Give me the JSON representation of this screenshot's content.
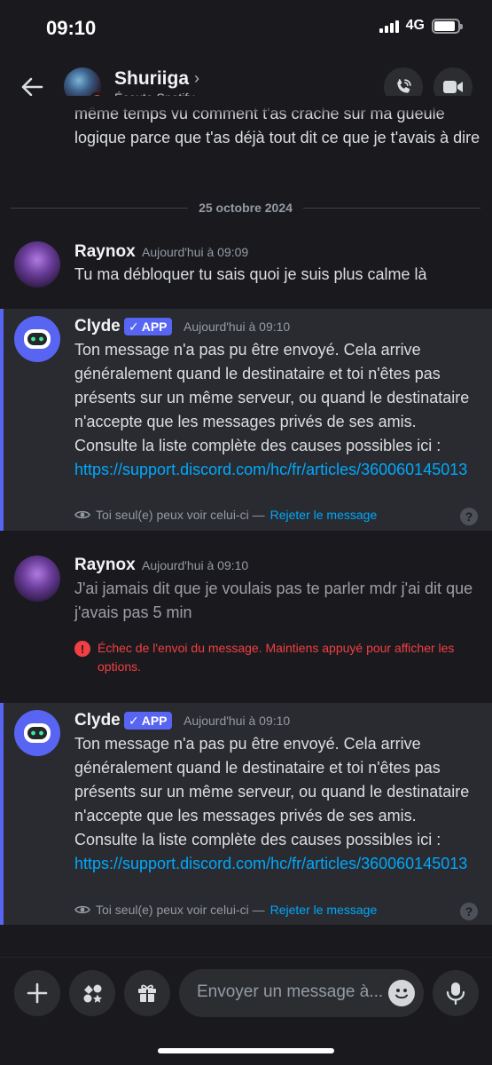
{
  "status_bar": {
    "time": "09:10",
    "network": "4G",
    "battery_fraction": 0.9
  },
  "header": {
    "user_name": "Shuriiga",
    "chevron": "›",
    "user_status": "Écoute Spotify",
    "icons": {
      "back": "arrow-left-icon",
      "call": "phone-call-icon",
      "video": "video-camera-icon"
    }
  },
  "chat": {
    "cut_off_text": "même temps vu comment t'as crache sur ma gueule logique parce que t'as déjà tout dit ce que je t'avais à dire",
    "date_divider": "25 octobre 2024",
    "messages": [
      {
        "author": "Raynox",
        "time": "Aujourd'hui à 09:09",
        "body": "Tu ma débloquer tu sais quoi je suis plus calme là"
      },
      {
        "author": "Clyde",
        "badge": "APP",
        "badge_check": "✓",
        "time": "Aujourd'hui à 09:10",
        "body": "Ton message n'a pas pu être envoyé. Cela arrive généralement quand le destinataire et toi n'êtes pas présents sur un même serveur, ou quand le destinataire n'accepte que les messages privés de ses amis. Consulte la liste complète des causes possibles ici : ",
        "link": "https://support.discord.com/hc/fr/articles/360060145013",
        "ephemeral_note": "Toi seul(e) peux voir celui-ci —",
        "dismiss_label": "Rejeter le message",
        "help": "?"
      },
      {
        "author": "Raynox",
        "time": "Aujourd'hui à 09:10",
        "body": "J'ai jamais dit que je voulais pas te parler mdr j'ai dit que j'avais pas 5 min",
        "error_icon": "!",
        "error_text": "Échec de l'envoi du message. Maintiens appuyé pour afficher les options."
      },
      {
        "author": "Clyde",
        "badge": "APP",
        "badge_check": "✓",
        "time": "Aujourd'hui à 09:10",
        "body": "Ton message n'a pas pu être envoyé. Cela arrive généralement quand le destinataire et toi n'êtes pas présents sur un même serveur, ou quand le destinataire n'accepte que les messages privés de ses amis. Consulte la liste complète des causes possibles ici : ",
        "link": "https://support.discord.com/hc/fr/articles/360060145013",
        "ephemeral_note": "Toi seul(e) peux voir celui-ci —",
        "dismiss_label": "Rejeter le message",
        "help": "?"
      }
    ]
  },
  "composer": {
    "placeholder": "Envoyer un message à...",
    "icons": {
      "plus": "plus-icon",
      "apps": "apps-icon",
      "gift": "gift-icon",
      "emoji": "emoji-icon",
      "mic": "microphone-icon"
    }
  },
  "colors": {
    "accent": "#5865f2",
    "link": "#00a8fc",
    "error": "#f23f43",
    "background": "#1a1a1e"
  }
}
